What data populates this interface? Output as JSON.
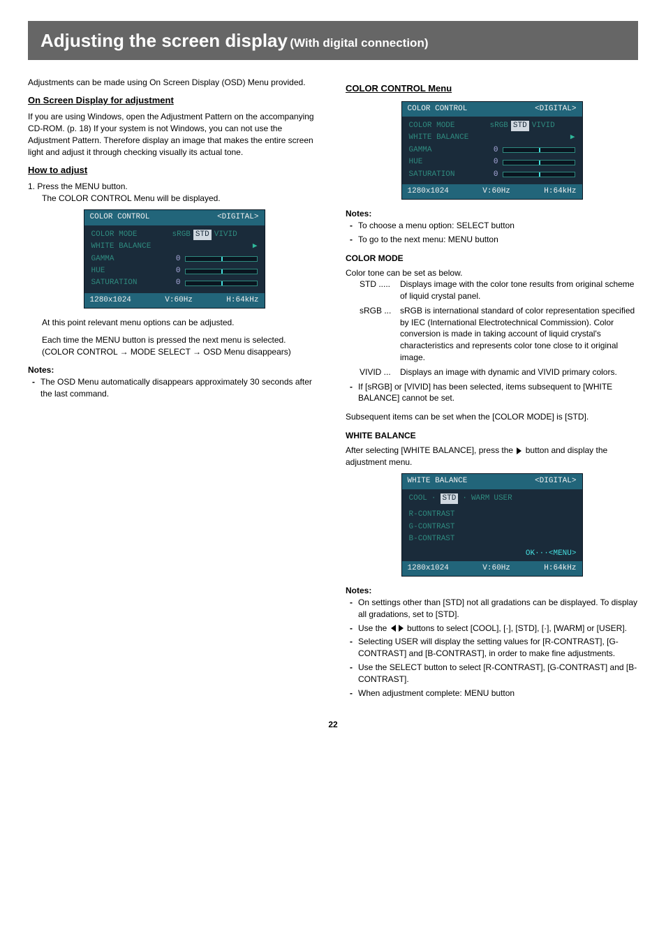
{
  "header": {
    "title": "Adjusting the screen display",
    "subtitle": "(With digital connection)"
  },
  "left": {
    "intro": "Adjustments can be made using On Screen Display (OSD) Menu provided.",
    "osd_title": "On Screen Display for adjustment",
    "osd_text": "If you are using Windows, open the Adjustment Pattern on the accompanying CD-ROM. (p. 18) If your system is not Windows, you can not use the Adjustment Pattern. Therefore display an image that makes the entire screen light and adjust it through checking visually its actual tone.",
    "how_title": "How to adjust",
    "step1": "1.  Press the MENU button.",
    "step1_sub": "The COLOR CONTROL Menu will be displayed.",
    "after_box1": "At this point relevant menu options can be adjusted.",
    "after_box2": "Each time the MENU button is pressed the next menu is selected. (COLOR CONTROL → MODE SELECT → OSD Menu disappears)",
    "notes_label": "Notes:",
    "note1": "The OSD Menu automatically disappears approximately 30 seconds after the last command."
  },
  "right": {
    "cc_title": "COLOR CONTROL Menu",
    "notes_label": "Notes:",
    "cc_note1": "To choose a menu option: SELECT button",
    "cc_note2": "To go to the next menu:    MENU button",
    "cm_title": "COLOR MODE",
    "cm_intro": "Color tone can be set as below.",
    "cm_std_term": "STD .....",
    "cm_std_desc": "Displays image with the color tone results from original scheme of liquid crystal panel.",
    "cm_srgb_term": "sRGB ...",
    "cm_srgb_desc": "sRGB is international standard of color representation specified by IEC (International Electrotechnical Commission). Color conversion is made in taking account of liquid crystal's characteristics and represents color tone close to it original image.",
    "cm_vivid_term": "VIVID ...",
    "cm_vivid_desc": "Displays an image with dynamic and VIVID primary colors.",
    "cm_footnote": "If [sRGB] or [VIVID] has been selected, items subsequent to [WHITE BALANCE] cannot be set.",
    "cm_after": "Subsequent items can be set when the [COLOR MODE] is [STD].",
    "wb_title": "WHITE BALANCE",
    "wb_intro_a": "After selecting [WHITE BALANCE], press the ",
    "wb_intro_b": " button and display the adjustment menu.",
    "wb_notes_label": "Notes:",
    "wb_note1": "On settings other than [STD] not all gradations can be displayed. To display all gradations, set to [STD].",
    "wb_note2_a": "Use the ",
    "wb_note2_b": " buttons to select [COOL], [·], [STD], [·], [WARM] or [USER].",
    "wb_note3": "Selecting USER will display the setting values for [R-CONTRAST], [G-CONTRAST] and [B-CONTRAST], in order to make fine adjustments.",
    "wb_note4": "Use the SELECT button to select [R-CONTRAST], [G-CONTRAST] and [B-CONTRAST].",
    "wb_note5": "When adjustment complete:    MENU button"
  },
  "osd_color": {
    "header_left": "COLOR CONTROL",
    "header_right": "<DIGITAL>",
    "row_mode": "COLOR MODE",
    "mode_srgb": "sRGB",
    "mode_std": "STD",
    "mode_vivid": "VIVID",
    "row_wb": "WHITE BALANCE",
    "row_gamma": "GAMMA",
    "row_hue": "HUE",
    "row_sat": "SATURATION",
    "val0": "0",
    "footer_res": "1280x1024",
    "footer_v": "V:60Hz",
    "footer_h": "H:64kHz"
  },
  "osd_wb": {
    "header_left": "WHITE BALANCE",
    "header_right": "<DIGITAL>",
    "opt_cool": "COOL",
    "opt_dot1": "·",
    "opt_std": "STD",
    "opt_dot2": "·",
    "opt_warm": "WARM",
    "opt_user": "USER",
    "r": "R-CONTRAST",
    "g": "G-CONTRAST",
    "b": "B-CONTRAST",
    "ok_hint": "OK···<MENU>",
    "footer_res": "1280x1024",
    "footer_v": "V:60Hz",
    "footer_h": "H:64kHz"
  },
  "page_number": "22"
}
